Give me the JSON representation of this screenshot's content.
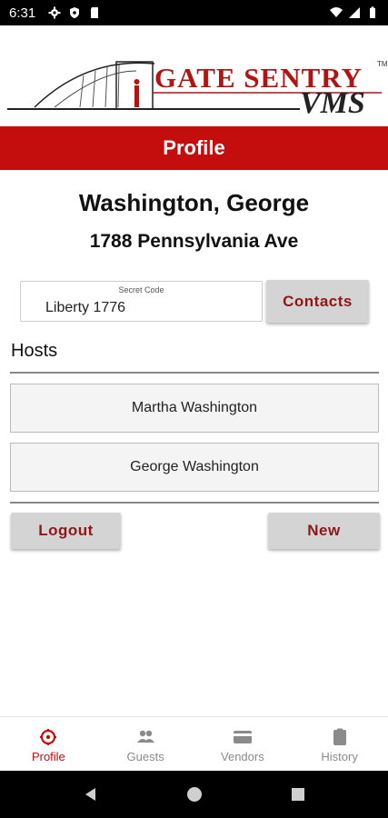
{
  "status_bar": {
    "time": "6:31"
  },
  "logo": {
    "title": "GATE SENTRY",
    "subtitle": "VMS",
    "trademark": "TM"
  },
  "header": {
    "title": "Profile"
  },
  "profile": {
    "name": "Washington, George",
    "address": "1788 Pennsylvania Ave",
    "secret_code": {
      "label": "Secret Code",
      "value": "Liberty 1776"
    },
    "contacts_label": "Contacts"
  },
  "hosts": {
    "label": "Hosts",
    "items": [
      "Martha Washington",
      "George Washington"
    ]
  },
  "actions": {
    "logout_label": "Logout",
    "new_label": "New"
  },
  "bottom_nav": {
    "items": [
      {
        "label": "Profile",
        "icon": "profile-icon",
        "active": true
      },
      {
        "label": "Guests",
        "icon": "guests-icon",
        "active": false
      },
      {
        "label": "Vendors",
        "icon": "vendors-icon",
        "active": false
      },
      {
        "label": "History",
        "icon": "history-icon",
        "active": false
      }
    ]
  },
  "colors": {
    "brand_red": "#c40d0d",
    "button_text": "#8f1717",
    "button_bg": "#d4d4d4"
  }
}
